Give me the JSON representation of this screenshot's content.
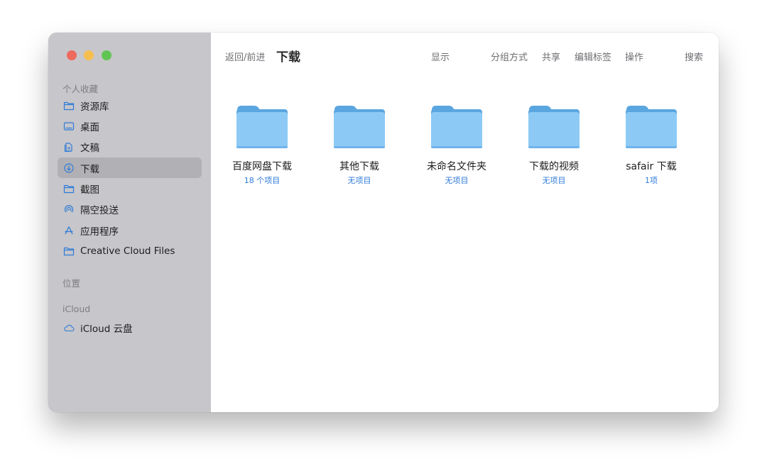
{
  "window": {
    "title": "下载"
  },
  "colors": {
    "sidebar_bg": "#c7c6ca",
    "sidebar_selected": "#b1b0b4",
    "folder_blue": "#8ccaf5",
    "accent_blue": "#2f7bd8",
    "traffic_red": "#ed6a5e",
    "traffic_yellow": "#f5bf4f",
    "traffic_green": "#61c554"
  },
  "sidebar": {
    "favorites_header": "个人收藏",
    "items": [
      {
        "label": "资源库",
        "icon": "folder-icon"
      },
      {
        "label": "桌面",
        "icon": "desktop-icon"
      },
      {
        "label": "文稿",
        "icon": "document-icon"
      },
      {
        "label": "下载",
        "icon": "download-icon",
        "selected": true
      },
      {
        "label": "截图",
        "icon": "folder-icon"
      },
      {
        "label": "隔空投送",
        "icon": "airdrop-icon"
      },
      {
        "label": "应用程序",
        "icon": "applications-icon"
      },
      {
        "label": "Creative Cloud Files",
        "icon": "folder-icon"
      }
    ],
    "locations_header": "位置",
    "icloud_header": "iCloud",
    "icloud_items": [
      {
        "label": "iCloud 云盘",
        "icon": "cloud-icon"
      }
    ]
  },
  "toolbar": {
    "back_forward": "返回/前进",
    "title": "下载",
    "view": "显示",
    "group": "分组方式",
    "share": "共享",
    "edit_tags": "编辑标签",
    "action": "操作",
    "search": "搜索"
  },
  "files": [
    {
      "name": "百度网盘下载",
      "sub": "18 个项目"
    },
    {
      "name": "其他下载",
      "sub": "无项目"
    },
    {
      "name": "未命名文件夹",
      "sub": "无项目"
    },
    {
      "name": "下载的视频",
      "sub": "无项目"
    },
    {
      "name": "safair 下载",
      "sub": "1项"
    }
  ]
}
